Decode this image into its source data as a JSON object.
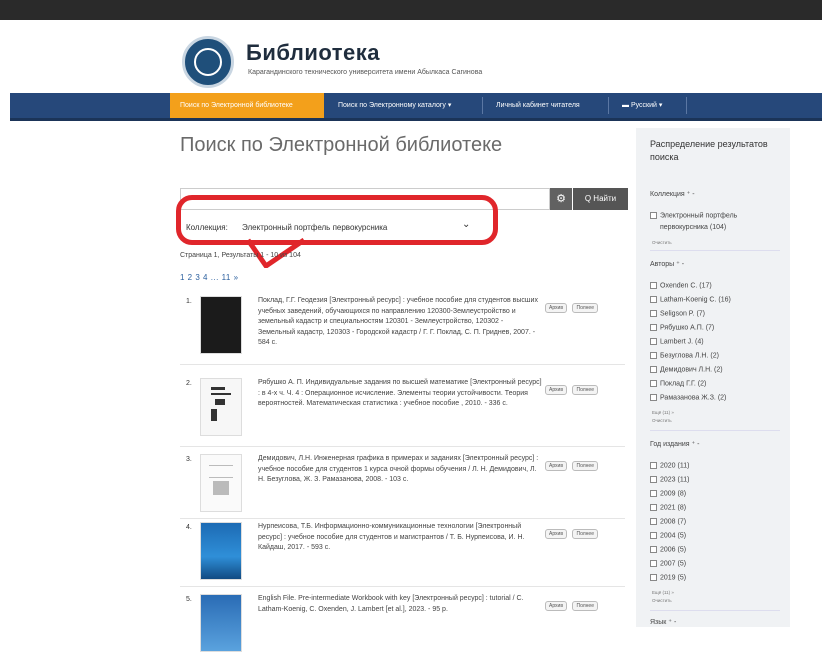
{
  "header": {
    "title": "Библиотека",
    "subtitle": "Карагандинского технического университета имени Абылкаса Сагинова"
  },
  "nav": {
    "items": [
      {
        "label": "Поиск по Электронной библиотеке",
        "active": true
      },
      {
        "label": "Поиск по Электронному каталогу ▾",
        "active": false
      },
      {
        "label": "Личный кабинет читателя",
        "active": false
      },
      {
        "label": "▬ Русский ▾",
        "active": false
      }
    ]
  },
  "main": {
    "page_title": "Поиск по Электронной библиотеке",
    "search": {
      "value": "",
      "button_label": "Q Найти",
      "options_icon": "gear-icon"
    },
    "filter": {
      "label": "Коллекция:",
      "value": "Электронный портфель первокурсника"
    },
    "pager_info": "Страница 1, Результаты 1 - 10 из 104",
    "pages": "1 2 3 4 ... 11 »",
    "result_buttons": [
      "Архив",
      "Полнее"
    ],
    "results": [
      {
        "num": "1.",
        "text": "Поклад, Г.Г. Геодезия [Электронный ресурс] : учебное пособие для студентов высших учебных заведений, обучающихся по направлению 120300-Землеустройство и земельный кадастр и специальностям 120301 - Землеустройство, 120302 - Земельный кадастр, 120303 - Городской кадастр / Г. Г. Поклад, С. П. Гриднев, 2007. - 584 с."
      },
      {
        "num": "2.",
        "text": "Рябушко А. П. Индивидуальные задания по высшей математике [Электронный ресурс] : в 4-х ч. Ч. 4 : Операционное исчисление. Элементы теории устойчивости. Теория вероятностей. Математическая статистика : учебное пособие , 2010. - 336 с."
      },
      {
        "num": "3.",
        "text": "Демидович, Л.Н. Инженерная графика в примерах и заданиях [Электронный ресурс] : учебное пособие для студентов 1 курса очной формы обучения / Л. Н. Демидович, Л. Н. Безуглова, Ж. З. Рамазанова, 2008. - 103 с."
      },
      {
        "num": "4.",
        "text": "Нурпеисова, Т.Б. Информационно-коммуникационные технологии [Электронный ресурс] : учебное пособие для студентов и магистрантов / Т. Б. Нурпеисова, И. Н. Кайдаш, 2017. - 593 с."
      },
      {
        "num": "5.",
        "text": "English File. Pre-intermediate Workbook with key [Электронный ресурс] : tutorial / C. Latham-Koenig, C. Oxenden, J. Lambert [et al.], 2023. - 95 p."
      }
    ]
  },
  "sidebar": {
    "title": "Распределение результатов поиска",
    "collection_head": "Коллекция ⁺ -",
    "collection_items": [
      "Электронный портфель",
      "первокурсника (104)"
    ],
    "show_all": "Очистить",
    "authors_head": "Авторы ⁺ -",
    "authors": [
      "Oxenden C. (17)",
      "Latham-Koenig C. (16)",
      "Seligson P. (7)",
      "Рябушко А.П. (7)",
      "Lambert J. (4)",
      "Безуглова Л.Н. (2)",
      "Демидович Л.Н. (2)",
      "Поклад Г.Г. (2)",
      "Рамазанова Ж.З. (2)"
    ],
    "authors_more": "Ещё (11) »",
    "year_head": "Год издания ⁺ -",
    "years": [
      "2020 (11)",
      "2023 (11)",
      "2009 (8)",
      "2021 (8)",
      "2008 (7)",
      "2004 (5)",
      "2006 (5)",
      "2007 (5)",
      "2019 (5)"
    ],
    "years_more": "Ещё (11) »",
    "lang_head": "Язык ⁺ -"
  }
}
